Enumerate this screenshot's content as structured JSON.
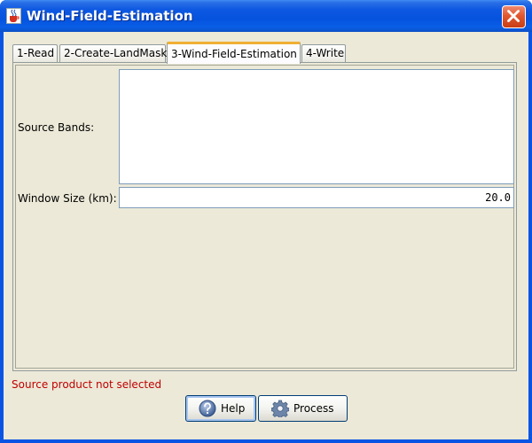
{
  "window": {
    "title": "Wind-Field-Estimation",
    "app_icon": "java-cup-icon",
    "close_icon": "close-x-icon"
  },
  "tabs": [
    {
      "label": "1-Read",
      "active": false
    },
    {
      "label": "2-Create-LandMask",
      "active": false
    },
    {
      "label": "3-Wind-Field-Estimation",
      "active": true
    },
    {
      "label": "4-Write",
      "active": false
    }
  ],
  "form": {
    "source_bands_label": "Source Bands:",
    "window_size_label": "Window Size (km):",
    "window_size_value": "20.0"
  },
  "status": {
    "message": "Source product not selected",
    "color": "#c00000"
  },
  "buttons": {
    "help_label": "Help",
    "help_icon": "help-question-icon",
    "process_label": "Process",
    "process_icon": "gear-icon"
  },
  "colors": {
    "titlebar": "#0553de",
    "background": "#ece9d8",
    "active_tab_accent": "#f0b033",
    "close_button": "#e0572f"
  }
}
